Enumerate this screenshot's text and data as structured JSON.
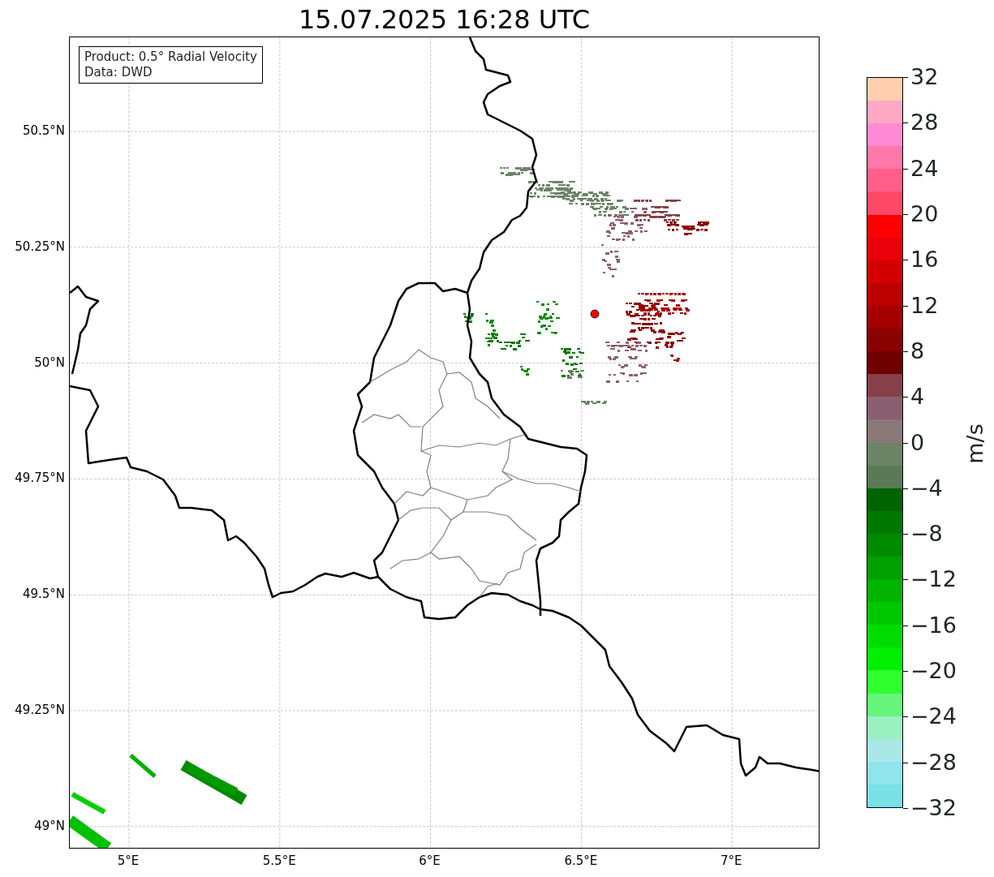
{
  "title": "15.07.2025 16:28 UTC",
  "legend": [
    "Product: 0.5° Radial Velocity",
    "Data: DWD"
  ],
  "map": {
    "lat_ticks": [
      "50.5°N",
      "50.25°N",
      "50°N",
      "49.75°N",
      "49.5°N",
      "49.25°N",
      "49°N"
    ],
    "lon_ticks": [
      "5°E",
      "5.5°E",
      "6°E",
      "6.5°E",
      "7°E"
    ]
  },
  "colorbar": {
    "label": "m/s",
    "ticks": [
      "32",
      "28",
      "24",
      "20",
      "16",
      "12",
      "8",
      "4",
      "0",
      "−4",
      "−8",
      "−12",
      "−16",
      "−20",
      "−24",
      "−28",
      "−32"
    ],
    "bins": [
      {
        "color": "#ffcfb0"
      },
      {
        "color": "#ffa8c4"
      },
      {
        "color": "#ff8ad4"
      },
      {
        "color": "#ff78a8"
      },
      {
        "color": "#ff5f88"
      },
      {
        "color": "#ff4866"
      },
      {
        "color": "#ff0000"
      },
      {
        "color": "#e8000a"
      },
      {
        "color": "#d40000"
      },
      {
        "color": "#bb0000"
      },
      {
        "color": "#a50000"
      },
      {
        "color": "#8b0000"
      },
      {
        "color": "#6e0000"
      },
      {
        "color": "#864048"
      },
      {
        "color": "#8a6070"
      },
      {
        "color": "#8b7878"
      },
      {
        "color": "#6b8466"
      },
      {
        "color": "#5a7a55"
      },
      {
        "color": "#006400"
      },
      {
        "color": "#007800"
      },
      {
        "color": "#008a00"
      },
      {
        "color": "#00a000"
      },
      {
        "color": "#00b400"
      },
      {
        "color": "#00c800"
      },
      {
        "color": "#00dc00"
      },
      {
        "color": "#00f000"
      },
      {
        "color": "#30ff30"
      },
      {
        "color": "#66f57a"
      },
      {
        "color": "#99f0c0"
      },
      {
        "color": "#aae8e8"
      },
      {
        "color": "#90e4ec"
      },
      {
        "color": "#78e0e6"
      }
    ]
  }
}
